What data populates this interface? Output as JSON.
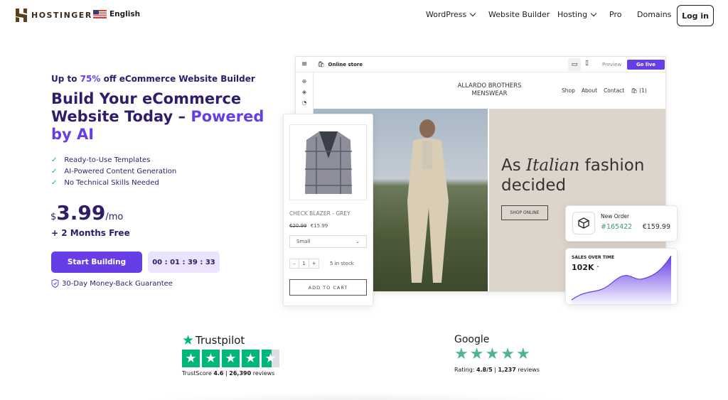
{
  "header": {
    "brand": "HOSTINGER",
    "language": "English",
    "nav": [
      {
        "label": "WordPress",
        "has_dropdown": true
      },
      {
        "label": "Website Builder",
        "has_dropdown": false
      },
      {
        "label": "Hosting",
        "has_dropdown": true
      },
      {
        "label": "Pro",
        "has_dropdown": false
      },
      {
        "label": "Domains",
        "has_dropdown": false
      }
    ],
    "login_label": "Log in"
  },
  "hero": {
    "tagline_pre": "Up to ",
    "tagline_highlight": "75%",
    "tagline_post": " off eCommerce Website Builder",
    "title_main": "Build Your eCommerce Website Today – ",
    "title_highlight": "Powered by AI",
    "features": [
      "Ready-to-Use Templates",
      "AI-Powered Content Generation",
      "No Technical Skills Needed"
    ],
    "currency": "$",
    "price": "3.99",
    "period": "/mo",
    "bonus": "+ 2 Months Free",
    "cta_label": "Start Building",
    "countdown": "00 : 01 : 39 : 33",
    "guarantee": "30-Day Money-Back Guarantee"
  },
  "editor": {
    "title": "Online store",
    "preview_label": "Preview",
    "go_live_label": "Go live",
    "store_name_line1": "ALLARDO BROTHERS",
    "store_name_line2": "MENSWEAR",
    "store_nav": [
      "Shop",
      "About",
      "Contact"
    ],
    "cart_count": "(1)",
    "hero_text_pre": "As ",
    "hero_text_italic": "Italian",
    "hero_text_post": " fashion decided",
    "shop_online_label": "SHOP ONLINE"
  },
  "product": {
    "name": "CHECK BLAZER - GREY",
    "old_price": "€20.99",
    "price": "€15.99",
    "size": "Small",
    "quantity": "1",
    "stock": "5 in stock",
    "add_to_cart": "ADD TO CART"
  },
  "order": {
    "label": "New Order",
    "id": "#165422",
    "amount": "€159.99"
  },
  "sales": {
    "label": "SALES OVER TIME",
    "value": "102K"
  },
  "trustpilot": {
    "brand": "Trustpilot",
    "score_label": "TrustScore",
    "score": "4.6",
    "reviews": "26,390",
    "reviews_label": "reviews",
    "rating": 4.6
  },
  "google": {
    "brand": "Google",
    "rating_label": "Rating:",
    "rating": "4.8/5",
    "reviews": "1,237",
    "reviews_label": "reviews"
  },
  "colors": {
    "accent": "#673de6",
    "navy": "#2f1c6a",
    "green": "#00b67a"
  }
}
